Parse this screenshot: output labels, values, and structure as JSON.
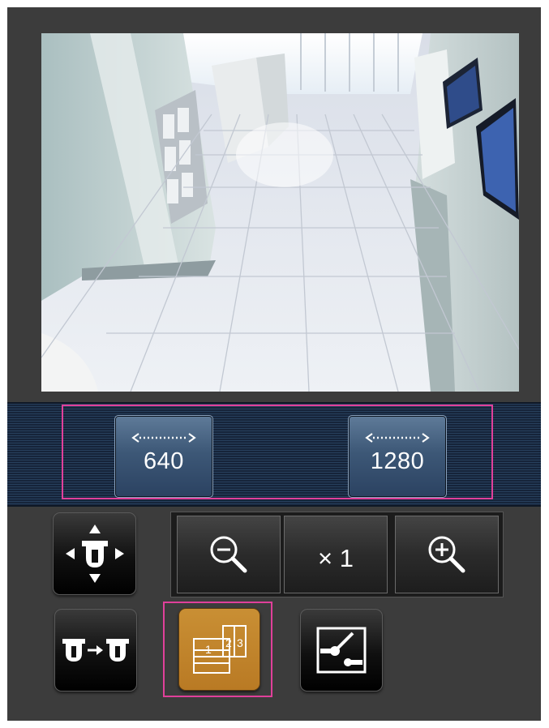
{
  "camera": {
    "feed": "live-camera-image",
    "scene": "office-corridor"
  },
  "resolution": {
    "buttons": [
      {
        "label": "640",
        "icon": "resize-arrows-icon"
      },
      {
        "label": "1280",
        "icon": "resize-arrows-icon"
      }
    ],
    "highlight_color": "#e0409a"
  },
  "controls": {
    "zoom": {
      "zoom_out_icon": "zoom-out-icon",
      "level_label": "× 1",
      "zoom_in_icon": "zoom-in-icon"
    },
    "pan_tilt_icon": "pan-tilt-arrows-icon",
    "switch_camera_icon": "camera-switch-icon",
    "multi_screen": {
      "icon": "multi-screen-icon",
      "labels": [
        "1",
        "2",
        "3"
      ],
      "active_color": "#c0862c"
    },
    "preset_icon": "preset-position-icon"
  }
}
